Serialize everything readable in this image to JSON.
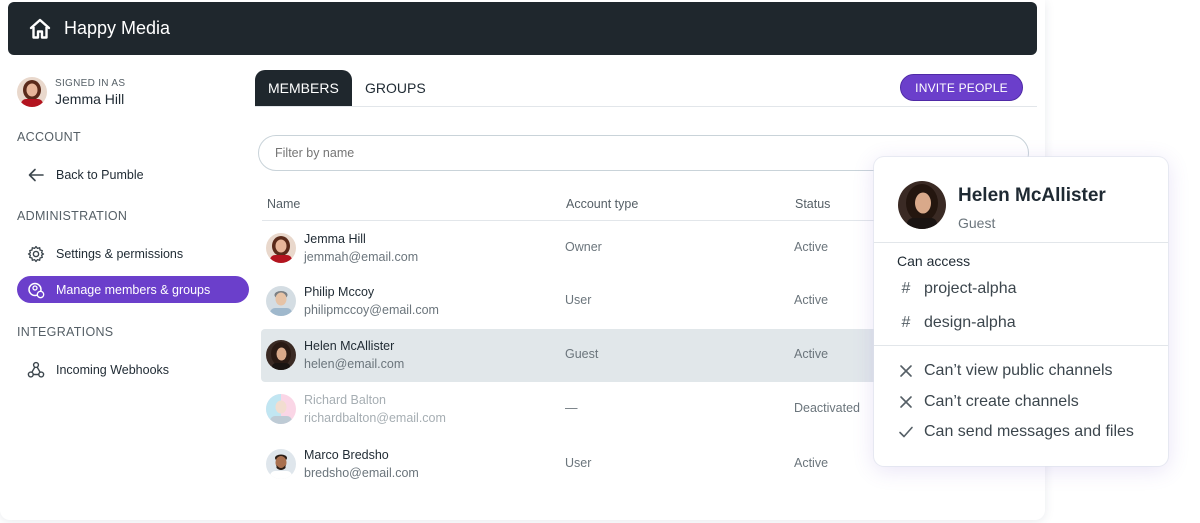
{
  "app": {
    "title": "Happy Media"
  },
  "sidebar": {
    "signed_in_caption": "SIGNED IN AS",
    "signed_in_user": "Jemma Hill",
    "sections": {
      "account": "ACCOUNT",
      "administration": "ADMINISTRATION",
      "integrations": "INTEGRATIONS"
    },
    "items": {
      "back": "Back to Pumble",
      "settings": "Settings & permissions",
      "manage": "Manage members & groups",
      "webhooks": "Incoming Webhooks"
    }
  },
  "tabs": {
    "members": "MEMBERS",
    "groups": "GROUPS"
  },
  "invite_label": "INVITE PEOPLE",
  "filter": {
    "placeholder": "Filter by name"
  },
  "table": {
    "headers": {
      "name": "Name",
      "account_type": "Account type",
      "status": "Status"
    },
    "rows": [
      {
        "name": "Jemma Hill",
        "email": "jemmah@email.com",
        "type": "Owner",
        "status": "Active"
      },
      {
        "name": "Philip Mccoy",
        "email": "philipmccoy@email.com",
        "type": "User",
        "status": "Active"
      },
      {
        "name": "Helen McAllister",
        "email": "helen@email.com",
        "type": "Guest",
        "status": "Active"
      },
      {
        "name": "Richard Balton",
        "email": "richardbalton@email.com",
        "type": "—",
        "status": "Deactivated"
      },
      {
        "name": "Marco Bredsho",
        "email": "bredsho@email.com",
        "type": "User",
        "status": "Active"
      }
    ]
  },
  "popover": {
    "name": "Helen McAllister",
    "role": "Guest",
    "access_title": "Can access",
    "channels": [
      "project-alpha",
      "design-alpha"
    ],
    "permissions": [
      {
        "icon": "x-icon",
        "text": "Can’t view public channels"
      },
      {
        "icon": "x-icon",
        "text": "Can’t create channels"
      },
      {
        "icon": "check-icon",
        "text": "Can send messages and files"
      }
    ]
  },
  "colors": {
    "accent": "#6b3fcb",
    "topbar": "#1f272d",
    "row_highlight": "#e1e7ea"
  }
}
